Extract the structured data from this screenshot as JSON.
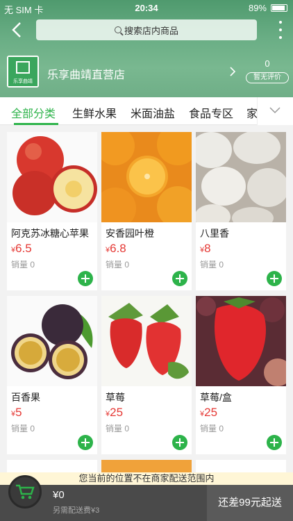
{
  "status_bar": {
    "carrier": "无 SIM 卡",
    "time": "20:34",
    "battery": "89%"
  },
  "search": {
    "placeholder": "搜索店内商品"
  },
  "shop": {
    "name": "乐享曲靖直营店",
    "logo_text": "乐享曲靖",
    "review_count": "0",
    "review_label": "暂无评价"
  },
  "tabs": [
    "全部分类",
    "生鲜水果",
    "米面油盐",
    "食品专区",
    "家"
  ],
  "currency": "¥",
  "sales_prefix": "销量",
  "products": [
    {
      "name": "阿克苏冰糖心苹果",
      "price": "6.5",
      "sales": "0",
      "image": "apple"
    },
    {
      "name": "安香园叶橙",
      "price": "6.8",
      "sales": "0",
      "image": "orange"
    },
    {
      "name": "八里香",
      "price": "8",
      "sales": "0",
      "image": "melon"
    },
    {
      "name": "百香果",
      "price": "5",
      "sales": "0",
      "image": "passionfruit"
    },
    {
      "name": "草莓",
      "price": "25",
      "sales": "0",
      "image": "strawberry"
    },
    {
      "name": "草莓/盒",
      "price": "25",
      "sales": "0",
      "image": "strawberry-box"
    }
  ],
  "notice": "您当前的位置不在商家配送范围内",
  "cart": {
    "total": "¥0",
    "delivery_fee": "另需配送费¥3",
    "checkout": "还差99元起送"
  },
  "colors": {
    "accent": "#2db34a",
    "price": "#e53935",
    "header": "#6aae85"
  }
}
